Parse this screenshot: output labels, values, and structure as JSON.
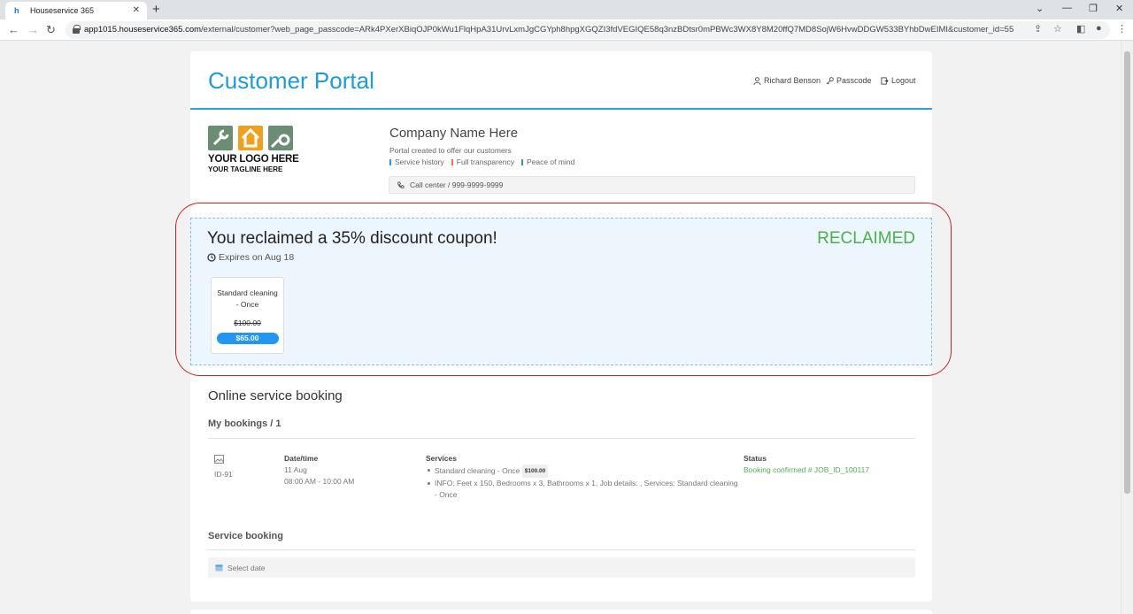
{
  "browser": {
    "tab_title": "Houseservice 365",
    "url_host": "app1015.houseservice365.com",
    "url_path": "/external/customer?web_page_passcode=ARk4PXerXBiqOJP0kWu1FlqHpA31UrvLxmJgCGYph8hpgXGQZI3fdVEGIQE58q3nzBDtsr0mPBWc3WX8Y8M20ffQ7MD8SojW6HvwDDGW533BYhbDwEIMI&customer_id=55"
  },
  "header": {
    "title": "Customer Portal",
    "user_label": "Richard Benson",
    "passcode_label": "Passcode",
    "logout_label": "Logout"
  },
  "company": {
    "logo_text": "YOUR LOGO HERE",
    "logo_tagline": "YOUR TAGLINE HERE",
    "name": "Company Name Here",
    "description": "Portal created to offer our customers",
    "features": [
      {
        "label": "Service history",
        "color": "#2196f3"
      },
      {
        "label": "Full transparency",
        "color": "#ff7043"
      },
      {
        "label": "Peace of mind",
        "color": "#26a69a"
      }
    ],
    "call_center": "Call center / 999-9999-9999"
  },
  "coupon": {
    "title": "You reclaimed a 35% discount coupon!",
    "status": "RECLAIMED",
    "expires": "Expires on Aug 18",
    "service_name": "Standard cleaning - Once",
    "old_price": "$100.00",
    "new_price": "$65.00"
  },
  "booking": {
    "section_title": "Online service booking",
    "my_bookings_title": "My bookings / 1",
    "col_datetime": "Date/time",
    "col_services": "Services",
    "col_status": "Status",
    "row": {
      "id": "ID-91",
      "date": "11 Aug",
      "time": "08:00 AM - 10:00 AM",
      "service": "Standard cleaning - Once",
      "service_price": "$100.00",
      "info_line1": "INFO: Feet x 150, Bedrooms x 3, Bathrooms x 1, Job details: , Services: Standard cleaning",
      "info_line2": "- Once",
      "status": "Booking confirmed # JOB_ID_100117"
    },
    "service_booking_title": "Service booking",
    "date_placeholder": "Select date"
  }
}
